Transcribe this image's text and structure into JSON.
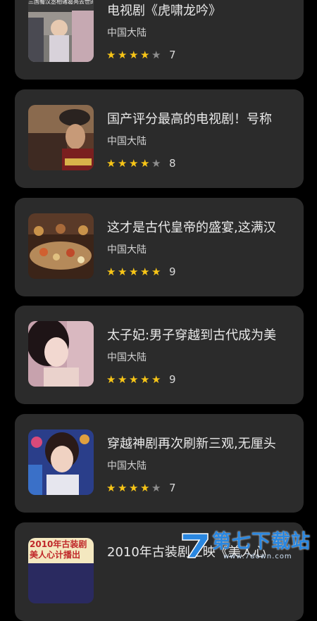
{
  "items": [
    {
      "title": "电视剧《虎啸龙吟》",
      "region": "中国大陆",
      "stars": 4,
      "score": "7",
      "thumb_caption": "三国蜀汉丞相诸葛亮去世的时候"
    },
    {
      "title": "国产评分最高的电视剧！号称",
      "region": "中国大陆",
      "stars": 4,
      "score": "8",
      "thumb_caption": ""
    },
    {
      "title": "这才是古代皇帝的盛宴,这满汉",
      "region": "中国大陆",
      "stars": 5,
      "score": "9",
      "thumb_caption": ""
    },
    {
      "title": "太子妃:男子穿越到古代成为美",
      "region": "中国大陆",
      "stars": 5,
      "score": "9",
      "thumb_caption": ""
    },
    {
      "title": "穿越神剧再次刷新三观,无厘头",
      "region": "中国大陆",
      "stars": 4,
      "score": "7",
      "thumb_caption": ""
    },
    {
      "title": "2010年古装剧上映《美人心",
      "region": "",
      "stars": 0,
      "score": "",
      "thumb_caption": "2010年古装剧 美人心计播出"
    }
  ],
  "watermark": {
    "text": "第七下载站",
    "url": "www.7down.com"
  },
  "colors": {
    "background": "#000000",
    "card": "#2b2b2b",
    "star_on": "#f7c517",
    "star_off": "#8d8d8d",
    "watermark": "#2a87e0"
  },
  "icons": {
    "star": "star-icon",
    "logo": "seven-logo-icon"
  }
}
